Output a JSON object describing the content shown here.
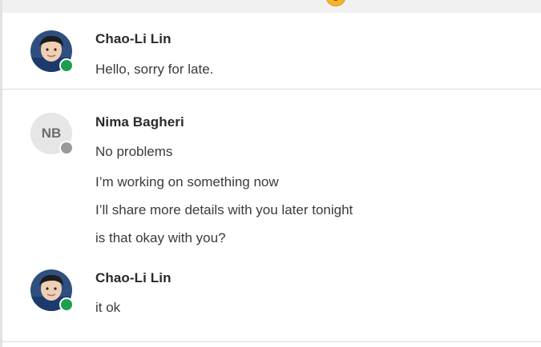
{
  "colors": {
    "online": "#1e9e4f",
    "offline": "#9a9a9a",
    "divider": "#dcdcdc"
  },
  "messages": [
    {
      "author": "Chao-Li Lin",
      "avatar": "photo",
      "status": "online",
      "lines": [
        "Hello, sorry for late."
      ]
    },
    {
      "author": "Nima Bagheri",
      "avatar_initials": "NB",
      "status": "offline",
      "lines": [
        "No problems",
        "I’m working on something now",
        "I’ll share more details with you later tonight",
        "is that okay with you?"
      ]
    },
    {
      "author": "Chao-Li Lin",
      "avatar": "photo",
      "status": "online",
      "lines": [
        "it ok"
      ]
    }
  ]
}
